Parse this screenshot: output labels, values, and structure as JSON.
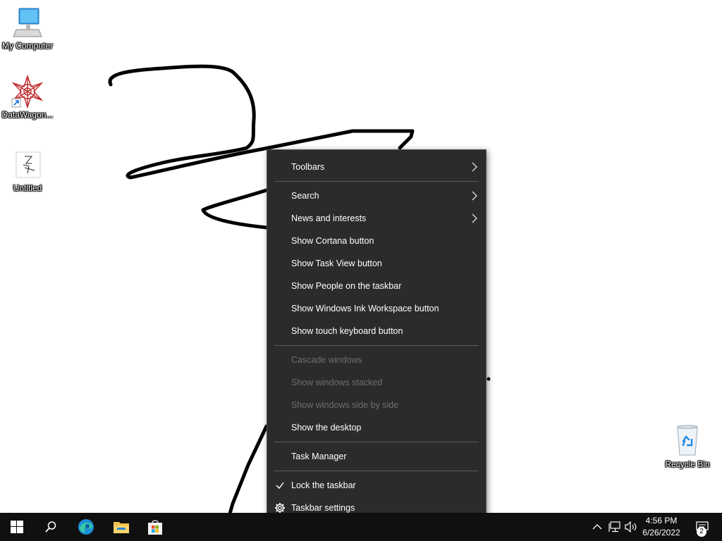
{
  "desktop": {
    "icons": [
      {
        "label": "My Computer",
        "icon": "computer-monitor-icon"
      },
      {
        "label": "DataWagon...",
        "icon": "datawagon-app-icon"
      },
      {
        "label": "Untitled",
        "icon": "paint-document-icon"
      },
      {
        "label": "Recycle Bin",
        "icon": "recycle-bin-icon"
      }
    ]
  },
  "context_menu": {
    "items": [
      {
        "label": "Toolbars",
        "submenu": true,
        "enabled": true
      },
      {
        "label": "Search",
        "submenu": true,
        "enabled": true
      },
      {
        "label": "News and interests",
        "submenu": true,
        "enabled": true
      },
      {
        "label": "Show Cortana button",
        "enabled": true
      },
      {
        "label": "Show Task View button",
        "enabled": true
      },
      {
        "label": "Show People on the taskbar",
        "enabled": true
      },
      {
        "label": "Show Windows Ink Workspace button",
        "enabled": true
      },
      {
        "label": "Show touch keyboard button",
        "enabled": true
      },
      {
        "label": "Cascade windows",
        "enabled": false
      },
      {
        "label": "Show windows stacked",
        "enabled": false
      },
      {
        "label": "Show windows side by side",
        "enabled": false
      },
      {
        "label": "Show the desktop",
        "enabled": true
      },
      {
        "label": "Task Manager",
        "enabled": true
      },
      {
        "label": "Lock the taskbar",
        "enabled": true,
        "checked": true
      },
      {
        "label": "Taskbar settings",
        "enabled": true,
        "icon": "gear-icon"
      }
    ]
  },
  "taskbar": {
    "buttons": [
      {
        "name": "start",
        "icon": "windows-logo-icon"
      },
      {
        "name": "search",
        "icon": "search-icon"
      },
      {
        "name": "edge",
        "icon": "edge-browser-icon"
      },
      {
        "name": "file-explorer",
        "icon": "folder-icon"
      },
      {
        "name": "store",
        "icon": "store-bag-icon"
      }
    ],
    "tray": {
      "time": "4:56 PM",
      "date": "6/26/2022",
      "notification_count": "2"
    }
  },
  "colors": {
    "menu_bg": "#2b2b2b",
    "menu_text": "#ffffff",
    "menu_disabled_text": "#6e6e6e",
    "taskbar_bg": "#101010"
  }
}
